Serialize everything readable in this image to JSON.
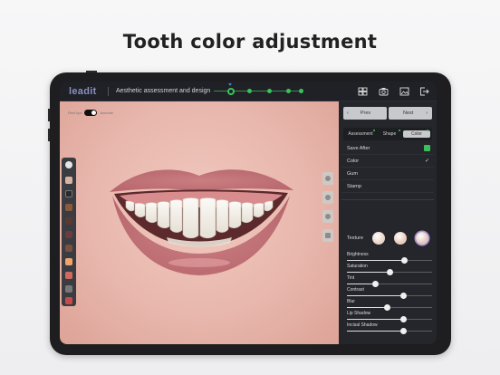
{
  "headline": "Tooth color adjustment",
  "app": {
    "logo": "leadit",
    "title": "Aesthetic assessment and design",
    "progress_steps": 5,
    "active_step": 1,
    "toolbar_icons": [
      "gallery-icon",
      "camera-icon",
      "image-export-icon",
      "logout-icon"
    ]
  },
  "photo": {
    "toggle_left_label": "Rest lips",
    "toggle_right_label": "Animate",
    "left_tools": [
      "chevron-right-icon",
      "face-icon",
      "face-dark-icon",
      "tooth-icon",
      "tooth-outline-icon",
      "lip-icon",
      "jaw-icon",
      "smile-icon",
      "mouth-icon",
      "grid-icon",
      "person-icon"
    ],
    "right_tools": [
      "face-view-icon",
      "profile-icon",
      "person-view-icon",
      "link-icon"
    ]
  },
  "panel": {
    "prev_label": "Prev",
    "next_label": "Next",
    "tabs": [
      {
        "label": "Assessment",
        "active": false
      },
      {
        "label": "Shape",
        "active": false
      },
      {
        "label": "Color",
        "active": true
      }
    ],
    "menu": [
      {
        "label": "Save After",
        "marker": "green-square"
      },
      {
        "label": "Color",
        "marker": "check"
      },
      {
        "label": "Gum",
        "marker": ""
      },
      {
        "label": "Stamp",
        "marker": ""
      }
    ],
    "texture_label": "Texture",
    "texture_swatches": [
      "#ead5c6",
      "#e8cbb9",
      "#e2c7c0"
    ],
    "selected_swatch": 2,
    "sliders": [
      {
        "label": "Brightness",
        "value": 0.68
      },
      {
        "label": "Saturation",
        "value": 0.5
      },
      {
        "label": "Tint",
        "value": 0.33
      },
      {
        "label": "Contrast",
        "value": 0.66
      },
      {
        "label": "Blur",
        "value": 0.47
      },
      {
        "label": "Lip Shadow",
        "value": 0.66
      },
      {
        "label": "Incisal Shadow",
        "value": 0.66
      }
    ],
    "check_mark": "✓"
  },
  "colors": {
    "accent_green": "#3cc05a",
    "logo_color": "#8a8fbf",
    "panel_bg": "#24262b"
  }
}
